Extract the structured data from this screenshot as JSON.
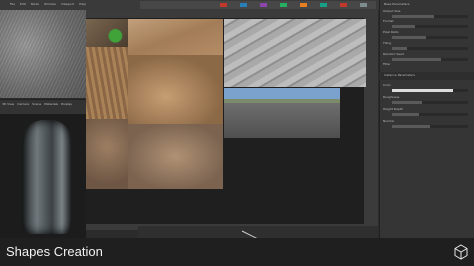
{
  "app": {
    "menu": [
      "File",
      "Edit",
      "Mode",
      "Window",
      "Viewport",
      "Help"
    ]
  },
  "panels": {
    "left_header_tabs": [
      "3D View",
      "Camera",
      "Scene",
      "Materials",
      "Display",
      "Renderer"
    ],
    "right": {
      "section1": "Base Parameters",
      "rows": [
        "Output Size",
        "Format",
        "Pixel Ratio",
        "Tiling",
        "Random Seed",
        "Filter",
        "Type",
        "Quality"
      ],
      "section2": "Instance Parameters",
      "rows2": [
        "Color",
        "Roughness",
        "Height Depth",
        "Normal"
      ]
    }
  },
  "swatches": [
    "#c0392b",
    "#2980b9",
    "#8e44ad",
    "#27ae60",
    "#e67e22",
    "#16a085",
    "#c0392b",
    "#7f8c8d"
  ],
  "footer": {
    "title": "Shapes Creation"
  },
  "logo": "cube-logo-icon"
}
